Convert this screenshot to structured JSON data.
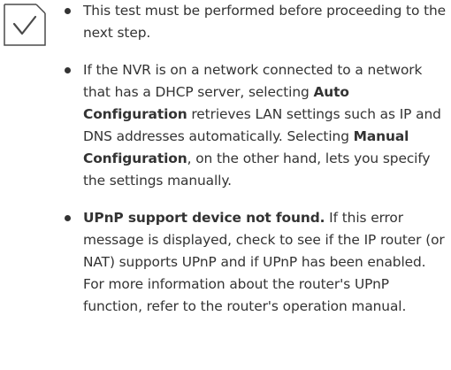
{
  "icon": {
    "name": "checkmark-icon",
    "color": "#4a4a4a"
  },
  "notes": {
    "item1": {
      "text": "This test must be performed before proceeding to the next step."
    },
    "item2": {
      "text_1": "If the NVR is on a network connected to a network that has a DHCP server, selecting ",
      "bold_1": "Auto Configuration",
      "text_2": " retrieves LAN settings such as IP and DNS addresses automatically. Selecting ",
      "bold_2": "Manual Configuration",
      "text_3": ", on the other hand, lets you specify the settings manually."
    },
    "item3": {
      "bold_1": "UPnP support device not found.",
      "text_1": " If this error message is displayed, check to see if the IP router (or NAT) supports UPnP and if UPnP has been enabled. For more information about the router's UPnP function, refer to the router's operation manual."
    }
  }
}
